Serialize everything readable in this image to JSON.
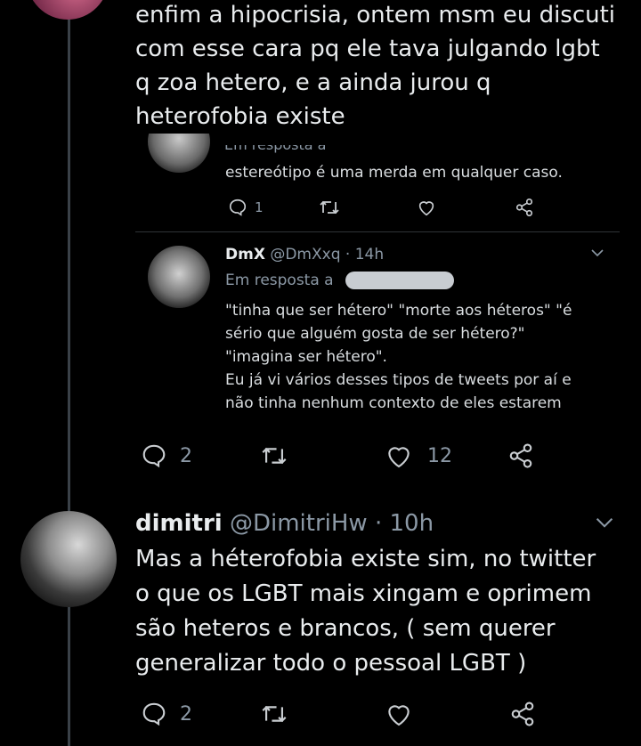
{
  "tweet_top": {
    "text_lines": [
      "enfim a hipocrisia, ontem msm eu discuti",
      "com esse cara pq ele tava julgando lgbt",
      "q zoa hetero, e a ainda jurou q",
      "heterofobia existe"
    ]
  },
  "quoted_reply": {
    "reply_to_label": "Em resposta a",
    "text": "estereótipo é uma merda em qualquer caso.",
    "reply_count": "1"
  },
  "nested_tweet": {
    "display_name": "DmX",
    "handle": "@DmXxq",
    "time": "· 14h",
    "reply_to_label": "Em resposta a",
    "text_lines": [
      "\"tinha que ser hétero\" \"morte aos héteros\" \"é",
      "sério que alguém gosta de ser hétero?\"",
      "\"imagina ser hétero\".",
      "Eu já vi vários desses tipos de tweets por aí e",
      "não tinha nenhum contexto de eles estarem"
    ]
  },
  "tweet_top_actions": {
    "reply_count": "2",
    "like_count": "12"
  },
  "tweet_bottom": {
    "display_name": "dimitri",
    "handle": "@DimitriHw",
    "time": "· 10h",
    "text_lines": [
      "Mas a héterofobia existe sim, no twitter",
      "o que os LGBT mais xingam e oprimem",
      "são heteros e brancos, ( sem querer",
      "generalizar todo o pessoal LGBT )"
    ],
    "reply_count": "2"
  },
  "colors": {
    "background": "#000000",
    "text": "#e9ecee",
    "muted": "#8b98a5",
    "thread_line": "#3a4148"
  }
}
